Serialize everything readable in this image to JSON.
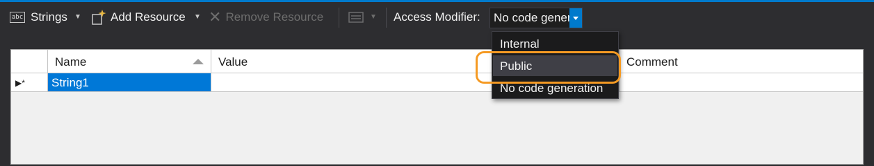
{
  "toolbar": {
    "strings_label": "Strings",
    "abc_icon_text": "abc",
    "add_resource_label": "Add Resource",
    "remove_resource_label": "Remove Resource",
    "access_modifier_label": "Access Modifier:",
    "access_modifier_value": "No code generation"
  },
  "dropdown": {
    "options": [
      "Internal",
      "Public",
      "No code generation"
    ],
    "hovered": "Public"
  },
  "grid": {
    "columns": {
      "name": "Name",
      "value": "Value",
      "comment": "Comment"
    },
    "sort": "ascending",
    "rows": [
      {
        "marker": "▶*",
        "name": "String1",
        "value": "",
        "comment": ""
      }
    ]
  },
  "colors": {
    "accent": "#007acc",
    "selection": "#0078d7",
    "highlight_ring": "#f59a23",
    "toolbar_bg": "#2d2d30"
  }
}
